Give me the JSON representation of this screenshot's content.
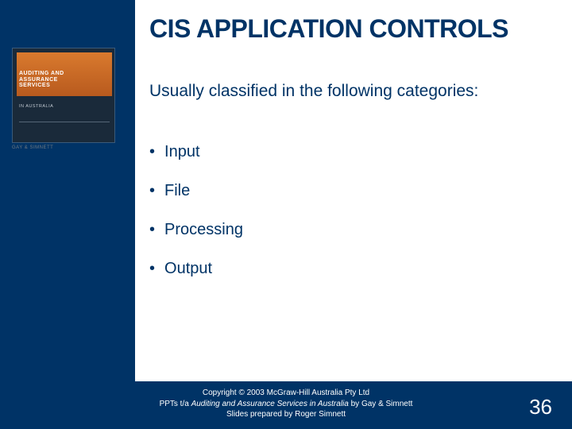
{
  "sidebar": {
    "logo_main": "AUDITING AND\nASSURANCE\nSERVICES",
    "logo_sub": "IN AUSTRALIA",
    "author": "GAY & SIMNETT"
  },
  "title": "CIS APPLICATION CONTROLS",
  "subtitle": "Usually classified in the following categories:",
  "bullets": [
    "Input",
    "File",
    "Processing",
    "Output"
  ],
  "footer": {
    "line1_pre": "Copyright ",
    "line1_sym": "©",
    "line1_post": " 2003 McGraw-Hill Australia Pty Ltd",
    "line2_pre": "PPTs t/a ",
    "line2_em": "Auditing and Assurance Services in Australia ",
    "line2_post": "by Gay & Simnett",
    "line3": "Slides prepared by Roger Simnett"
  },
  "page_number": "36"
}
